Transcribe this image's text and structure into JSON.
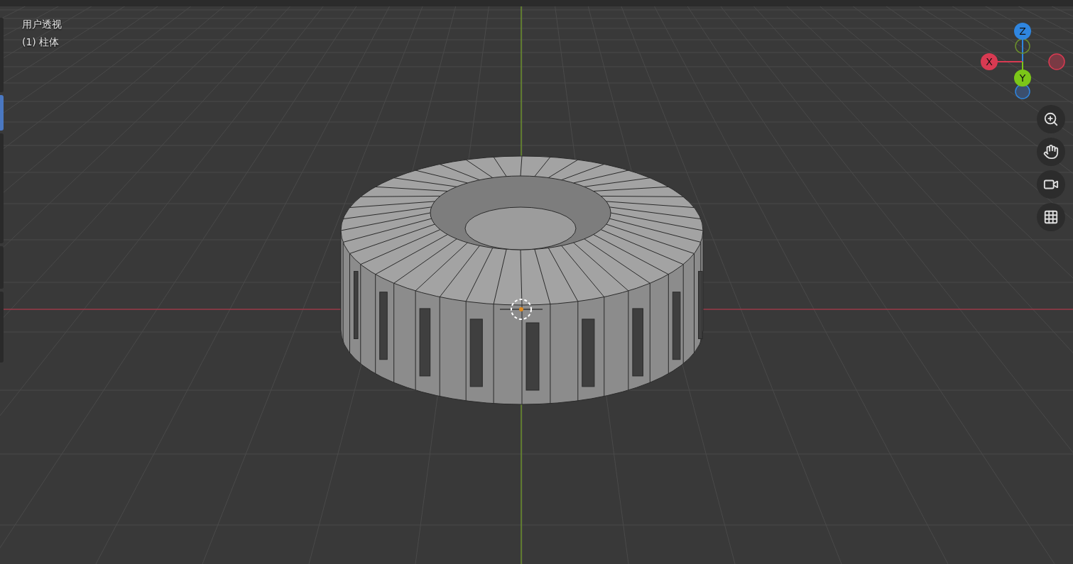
{
  "viewport": {
    "view_name": "用户透视",
    "object_label": "(1) 柱体"
  },
  "toolbar": {
    "tools": [
      {
        "selected": false
      },
      {
        "selected": true
      },
      {
        "selected": false
      },
      {
        "selected": false
      },
      {
        "selected": false
      }
    ]
  },
  "gizmo": {
    "axes": [
      {
        "label": "Z",
        "color": "#2f86e0"
      },
      {
        "label": "X",
        "color": "#d83a52"
      },
      {
        "label": "Y",
        "color": "#7bc618"
      }
    ]
  },
  "nav_buttons": [
    {
      "kind": "zoom"
    },
    {
      "kind": "pan"
    },
    {
      "kind": "camera"
    },
    {
      "kind": "grid"
    }
  ]
}
